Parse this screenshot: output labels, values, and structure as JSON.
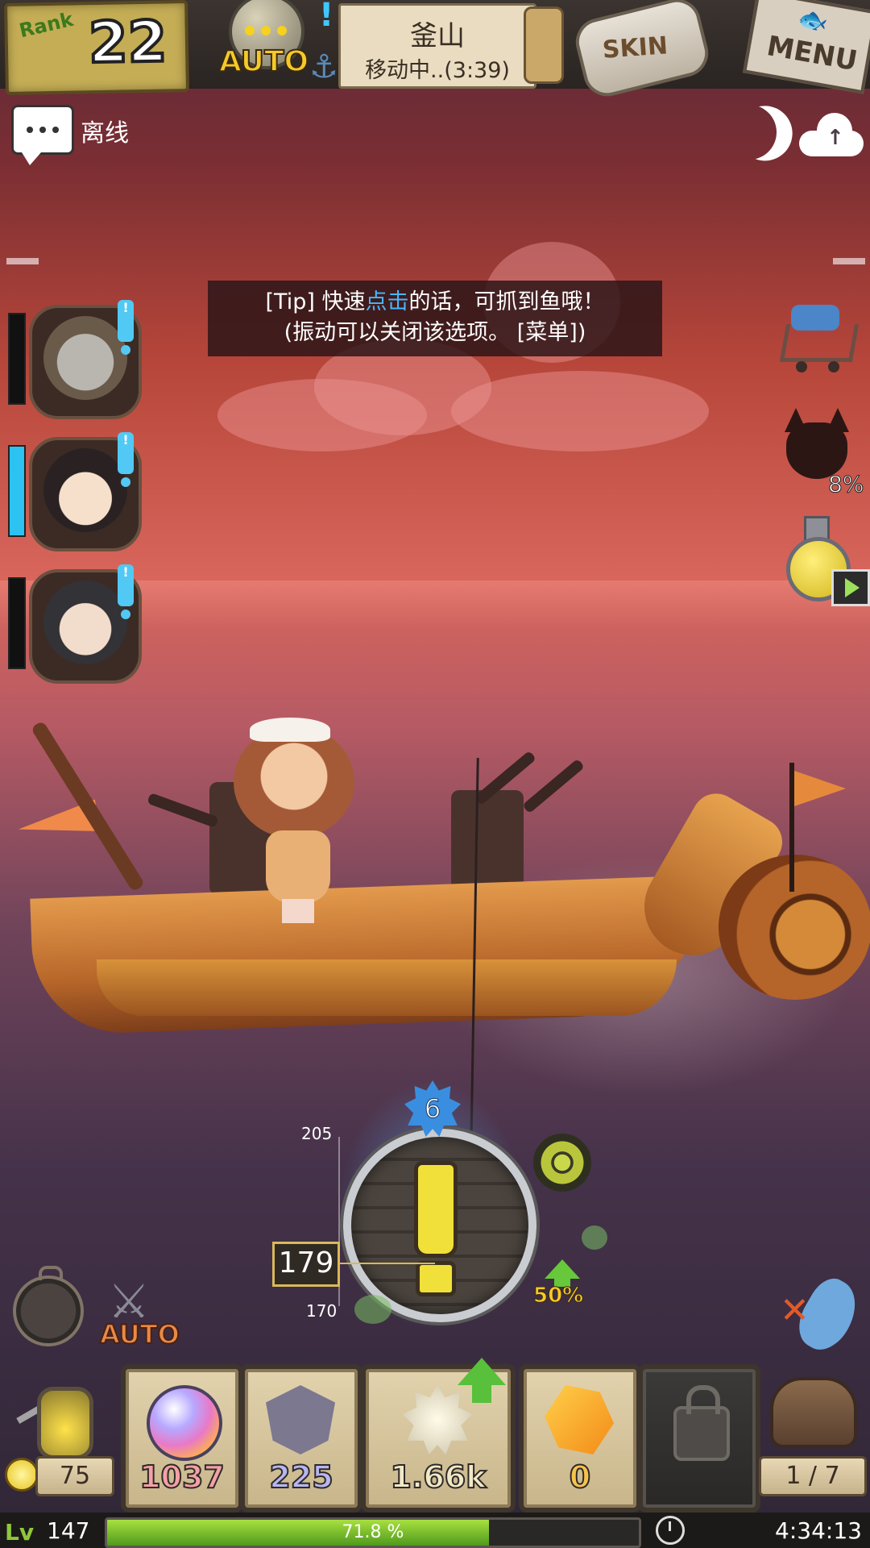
{
  "header": {
    "rank_label": "Rank",
    "rank_value": "22",
    "auto_label": "AUTO",
    "location_name": "釜山",
    "location_status": "移动中..(3:39)",
    "skin_label": "SKIN",
    "menu_label": "MENU"
  },
  "chat": {
    "status": "离线"
  },
  "tip": {
    "line1_prefix": "[Tip] 快速",
    "line1_highlight": "点击",
    "line1_suffix": "的话，可抓到鱼哦！",
    "line2": "(振动可以关闭该选项。 [菜单])"
  },
  "side_right": {
    "mask_percent": "8%"
  },
  "gauge": {
    "star_level": "6",
    "tick_top": "205",
    "tick_bottom": "170",
    "current_depth": "179",
    "boost_percent": "50%"
  },
  "auto_battle_label": "AUTO",
  "bottom": {
    "coins": "75",
    "slots": [
      {
        "icon": "rainbow-orb-icon",
        "count": "1037"
      },
      {
        "icon": "skull-shield-icon",
        "count": "225"
      },
      {
        "icon": "shell-icon",
        "count": "1.66k"
      },
      {
        "icon": "amber-crystal-icon",
        "count": "0"
      },
      {
        "icon": "lock-icon",
        "count": ""
      }
    ],
    "chest_count": "1 / 7"
  },
  "status": {
    "level": "147",
    "xp_percent_label": "71.8 %",
    "xp_fraction": 0.718,
    "timer": "4:34:13"
  },
  "colors": {
    "accent_blue": "#48b6ff",
    "xp_green": "#8ec83a",
    "slot_count_pink": "#f3a0a6"
  }
}
